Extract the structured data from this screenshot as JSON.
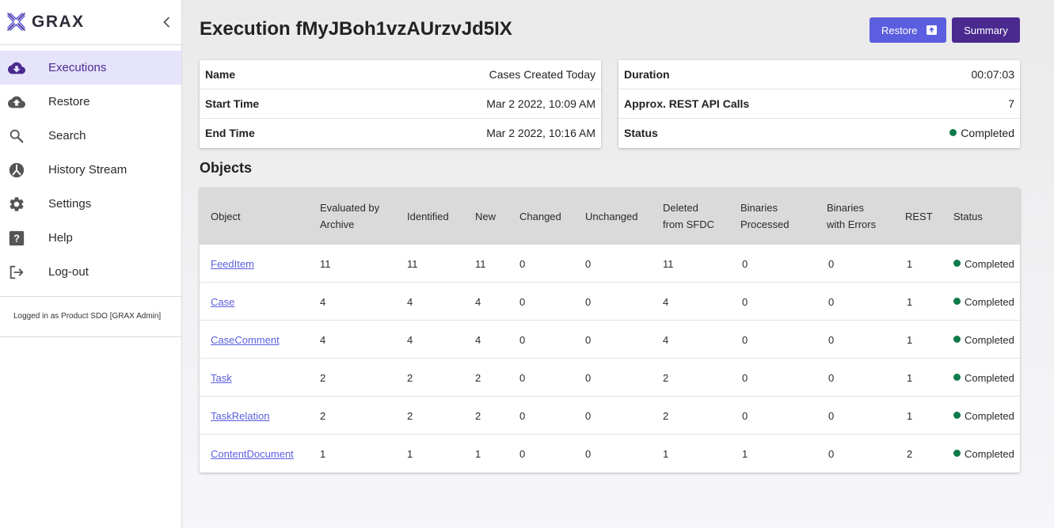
{
  "brand": {
    "name": "GRAX"
  },
  "sidebar": {
    "items": [
      {
        "label": "Executions",
        "icon": "cloud-download-icon",
        "active": true
      },
      {
        "label": "Restore",
        "icon": "cloud-upload-icon",
        "active": false
      },
      {
        "label": "Search",
        "icon": "search-icon",
        "active": false
      },
      {
        "label": "History Stream",
        "icon": "history-stream-icon",
        "active": false
      },
      {
        "label": "Settings",
        "icon": "gear-icon",
        "active": false
      },
      {
        "label": "Help",
        "icon": "help-icon",
        "active": false
      },
      {
        "label": "Log-out",
        "icon": "logout-icon",
        "active": false
      }
    ],
    "logged_in": "Logged in as Product SDO [GRAX Admin]"
  },
  "header": {
    "title": "Execution fMyJBoh1vzAUrzvJd5IX",
    "restore_label": "Restore",
    "summary_label": "Summary"
  },
  "info_left": [
    {
      "label": "Name",
      "value": "Cases Created Today"
    },
    {
      "label": "Start Time",
      "value": "Mar 2 2022, 10:09 AM"
    },
    {
      "label": "End Time",
      "value": "Mar 2 2022, 10:16 AM"
    }
  ],
  "info_right": [
    {
      "label": "Duration",
      "value": "00:07:03"
    },
    {
      "label": "Approx. REST API Calls",
      "value": "7"
    },
    {
      "label": "Status",
      "value": "Completed"
    }
  ],
  "objects": {
    "title": "Objects",
    "columns": {
      "object": "Object",
      "evaluated_1": "Evaluated by",
      "evaluated_2": "Archive",
      "identified": "Identified",
      "new": "New",
      "changed": "Changed",
      "unchanged": "Unchanged",
      "deleted_1": "Deleted",
      "deleted_2": "from SFDC",
      "binproc_1": "Binaries",
      "binproc_2": "Processed",
      "binerr_1": "Binaries",
      "binerr_2": "with Errors",
      "rest": "REST",
      "status": "Status"
    },
    "rows": [
      {
        "object": "FeedItem",
        "evaluated": "11",
        "identified": "11",
        "new": "11",
        "changed": "0",
        "unchanged": "0",
        "deleted": "11",
        "binproc": "0",
        "binerr": "0",
        "rest": "1",
        "status": "Completed"
      },
      {
        "object": "Case",
        "evaluated": "4",
        "identified": "4",
        "new": "4",
        "changed": "0",
        "unchanged": "0",
        "deleted": "4",
        "binproc": "0",
        "binerr": "0",
        "rest": "1",
        "status": "Completed"
      },
      {
        "object": "CaseComment",
        "evaluated": "4",
        "identified": "4",
        "new": "4",
        "changed": "0",
        "unchanged": "0",
        "deleted": "4",
        "binproc": "0",
        "binerr": "0",
        "rest": "1",
        "status": "Completed"
      },
      {
        "object": "Task",
        "evaluated": "2",
        "identified": "2",
        "new": "2",
        "changed": "0",
        "unchanged": "0",
        "deleted": "2",
        "binproc": "0",
        "binerr": "0",
        "rest": "1",
        "status": "Completed"
      },
      {
        "object": "TaskRelation",
        "evaluated": "2",
        "identified": "2",
        "new": "2",
        "changed": "0",
        "unchanged": "0",
        "deleted": "2",
        "binproc": "0",
        "binerr": "0",
        "rest": "1",
        "status": "Completed"
      },
      {
        "object": "ContentDocument",
        "evaluated": "1",
        "identified": "1",
        "new": "1",
        "changed": "0",
        "unchanged": "0",
        "deleted": "1",
        "binproc": "1",
        "binerr": "0",
        "rest": "2",
        "status": "Completed"
      }
    ]
  },
  "colors": {
    "accent": "#5b5ede",
    "brand_purple": "#4a2a8f",
    "status_green": "#0e7a4a",
    "active_bg": "#e6e4fb"
  }
}
